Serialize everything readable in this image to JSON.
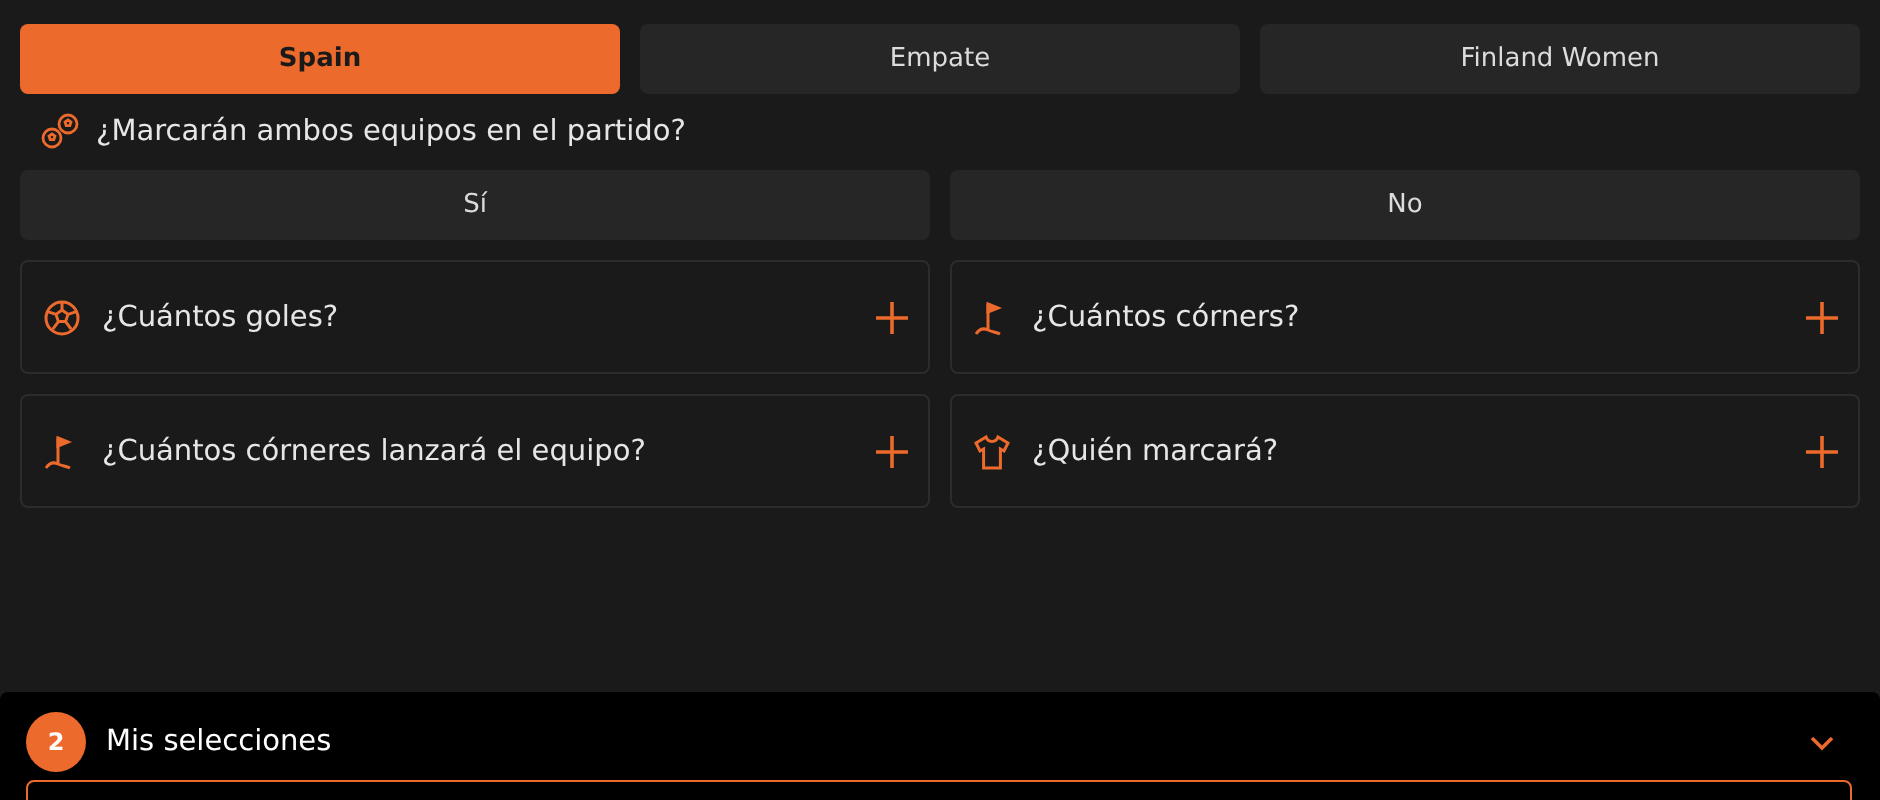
{
  "winner_options": [
    {
      "label": "Spain",
      "selected": true
    },
    {
      "label": "Empate",
      "selected": false
    },
    {
      "label": "Finland Women",
      "selected": false
    }
  ],
  "both_score": {
    "question": "¿Marcarán ambos equipos en el partido?",
    "options": [
      {
        "label": "Sí",
        "selected": false
      },
      {
        "label": "No",
        "selected": false
      }
    ]
  },
  "markets": [
    {
      "kind": "ball",
      "title": "¿Cuántos goles?",
      "expanded": false
    },
    {
      "kind": "corner",
      "title": "¿Cuántos córners?",
      "expanded": false
    },
    {
      "kind": "corner",
      "title": "¿Cuántos córneres lanzará el equipo?",
      "expanded": false
    },
    {
      "kind": "shirt",
      "title": "¿Quién marcará?",
      "expanded": false
    }
  ],
  "selections": {
    "count": "2",
    "title": "Mis selecciones",
    "expanded": false
  }
}
